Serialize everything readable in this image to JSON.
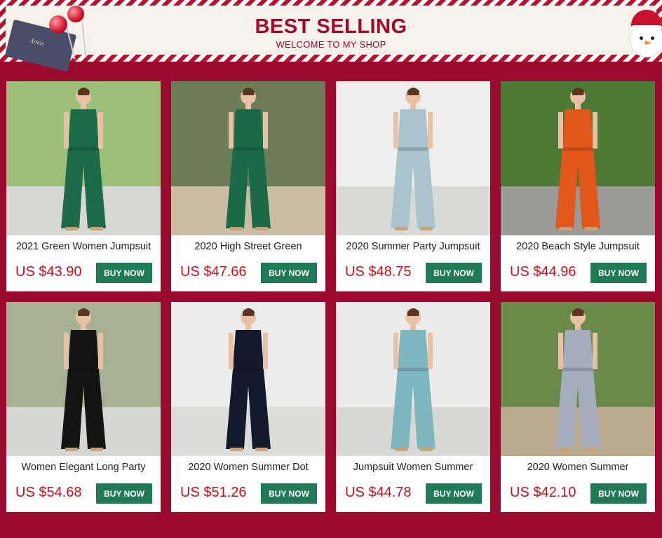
{
  "banner": {
    "title": "BEST SELLING",
    "subtitle": "WELCOME TO MY SHOP",
    "gift_text": "Xmas"
  },
  "colors": {
    "background": "#9a0a2e",
    "accent_text": "#a3072a",
    "price": "#c6121f",
    "button": "#1f7a55"
  },
  "products": [
    {
      "title": "2021 Green Women Jumpsuit",
      "price": "US $43.90",
      "button": "BUY NOW",
      "dress": "#1e6b4a",
      "bg": "#9cbf7a",
      "ground": "#d8d8d2"
    },
    {
      "title": "2020 High Street Green",
      "price": "US $47.66",
      "button": "BUY NOW",
      "dress": "#1a6b45",
      "bg": "#6d7d5a",
      "ground": "#cdbca4"
    },
    {
      "title": "2020 Summer Party Jumpsuit",
      "price": "US $48.75",
      "button": "BUY NOW",
      "dress": "#a9c4cc",
      "bg": "#eeeeec",
      "ground": "#d9d9d6"
    },
    {
      "title": "2020 Beach Style Jumpsuit",
      "price": "US $44.96",
      "button": "BUY NOW",
      "dress": "#e2571b",
      "bg": "#4f7a35",
      "ground": "#9a9a96"
    },
    {
      "title": "Women Elegant Long Party",
      "price": "US $54.68",
      "button": "BUY NOW",
      "dress": "#141414",
      "bg": "#a7b090",
      "ground": "#d6d6d2"
    },
    {
      "title": "2020 Women Summer Dot",
      "price": "US $51.26",
      "button": "BUY NOW",
      "dress": "#141a2e",
      "bg": "#ececea",
      "ground": "#dcdcd8"
    },
    {
      "title": "Jumpsuit Women Summer",
      "price": "US $44.78",
      "button": "BUY NOW",
      "dress": "#7fb7c0",
      "bg": "#ebebea",
      "ground": "#d8d8d5"
    },
    {
      "title": "2020 Women Summer",
      "price": "US $42.10",
      "button": "BUY NOW",
      "dress": "#a5adbd",
      "bg": "#6a8a4a",
      "ground": "#b9a98f"
    }
  ]
}
